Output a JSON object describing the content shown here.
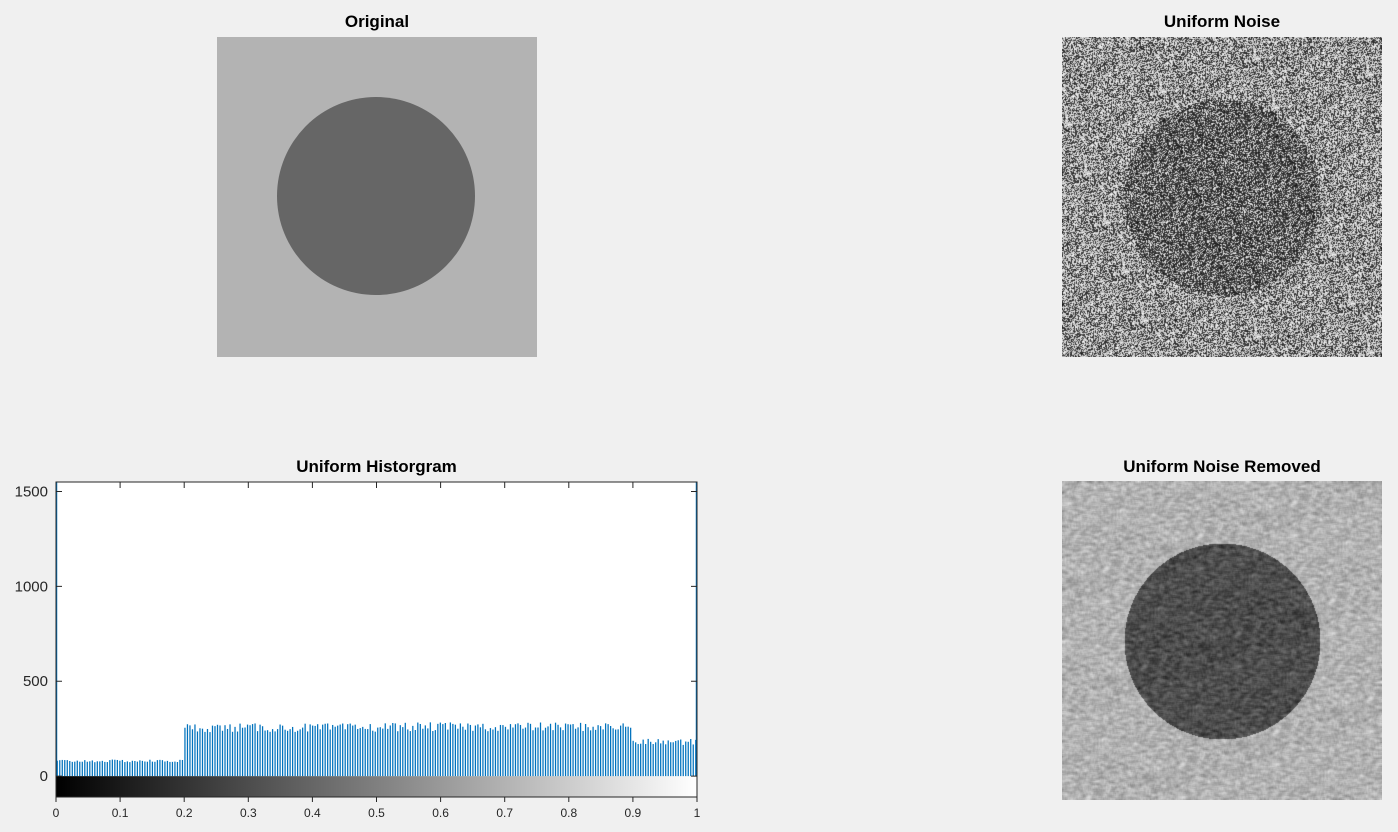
{
  "panels": {
    "original": {
      "title": "Original"
    },
    "noise": {
      "title": "Uniform Noise"
    },
    "histogram": {
      "title": "Uniform Historgram"
    },
    "removed": {
      "title": "Uniform Noise Removed"
    }
  },
  "images": {
    "original": {
      "background_gray": "#b3b3b3",
      "disk_gray": "#666666"
    },
    "noise": {
      "description_kind": "uniform-noise-image"
    },
    "removed": {
      "description_kind": "filtered-image"
    }
  },
  "chart_data": {
    "type": "bar",
    "title": "Uniform Historgram",
    "xlabel": "",
    "ylabel": "",
    "xlim": [
      0,
      1
    ],
    "ylim": [
      -110,
      1550
    ],
    "yticks": [
      0,
      500,
      1000,
      1500
    ],
    "yticklabels": [
      "0",
      "500",
      "1000",
      "1500"
    ],
    "xticks": [
      0,
      0.1,
      0.2,
      0.3,
      0.4,
      0.5,
      0.6,
      0.7,
      0.8,
      0.9,
      1
    ],
    "xticklabels": [
      "0",
      "0.1",
      "0.2",
      "0.3",
      "0.4",
      "0.5",
      "0.6",
      "0.7",
      "0.8",
      "0.9",
      "1"
    ],
    "bar_color": "#0072bd",
    "colorbar": {
      "range": [
        0,
        1
      ],
      "from": "#000000",
      "to": "#ffffff"
    },
    "series": [
      {
        "bins": 256,
        "segments": [
          {
            "x_from": 0.0,
            "x_to": 0.2,
            "value": 80
          },
          {
            "x_from": 0.2,
            "x_to": 0.5,
            "value": 255
          },
          {
            "x_from": 0.5,
            "x_to": 0.9,
            "value": 260
          },
          {
            "x_from": 0.9,
            "x_to": 1.0,
            "value": 180
          }
        ]
      }
    ]
  }
}
